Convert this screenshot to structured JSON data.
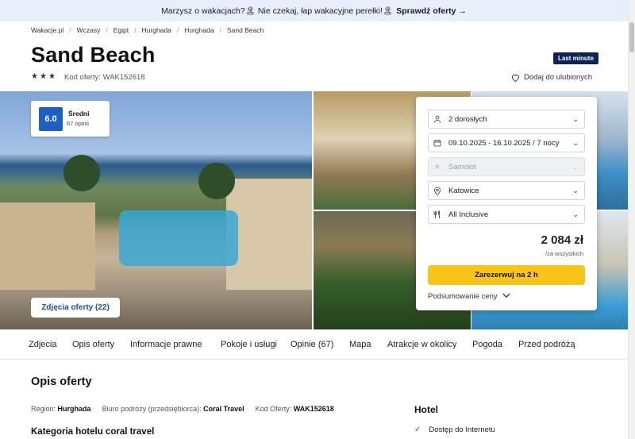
{
  "promo": {
    "text": "Marzysz o wakacjach?🏝 Nie czekaj, łap wakacyjne perełki!🏝",
    "cta": "Sprawdź oferty"
  },
  "breadcrumb": [
    "Wakacje.pl",
    "Wczasy",
    "Egipt",
    "Hurghada",
    "Hurghada",
    "Sand Beach"
  ],
  "hotel": {
    "name": "Sand Beach",
    "badge": "Last minute",
    "stars": 3,
    "offer_code_label": "Kod oferty: WAK152618",
    "favorite_label": "Dodaj do ulubionych"
  },
  "rating": {
    "score": "6.0",
    "label": "Średni",
    "reviews": "67 opinii"
  },
  "gallery": {
    "photos_button": "Zdjęcia oferty (22)"
  },
  "booking": {
    "guests": "2 dorosłych",
    "dates": "09.10.2025 - 16.10.2025 / 7 nocy",
    "transport": "Samolot",
    "departure": "Katowice",
    "board": "All Inclusive",
    "price": "2 084 zł",
    "price_note": "/za wszystkich",
    "book_button": "Zarezerwuj na 2 h",
    "summary": "Podsumowanie ceny"
  },
  "nav": [
    "Zdjecia",
    "Opis oferty",
    "Informacje prawne",
    "Pokoje i usługi",
    "Opinie (67)",
    "Mapa",
    "Atrakcje w okolicy",
    "Pogoda",
    "Przed podróżą"
  ],
  "description": {
    "title": "Opis oferty",
    "region_label": "Region:",
    "region": "Hurghada",
    "operator_label": "Biuro podróży (przedsiębiorca):",
    "operator": "Coral Travel",
    "code_label": "Kod Oferty:",
    "code": "WAK152618",
    "category_title": "Kategoria hotelu coral travel"
  },
  "hotel_section": {
    "title": "Hotel",
    "amenities": [
      "Dostęp do Internetu"
    ]
  },
  "colors": {
    "accent": "#1d5fc4",
    "badge": "#0d2352",
    "cta": "#f6c519",
    "promo_bg": "#e9eefb"
  }
}
